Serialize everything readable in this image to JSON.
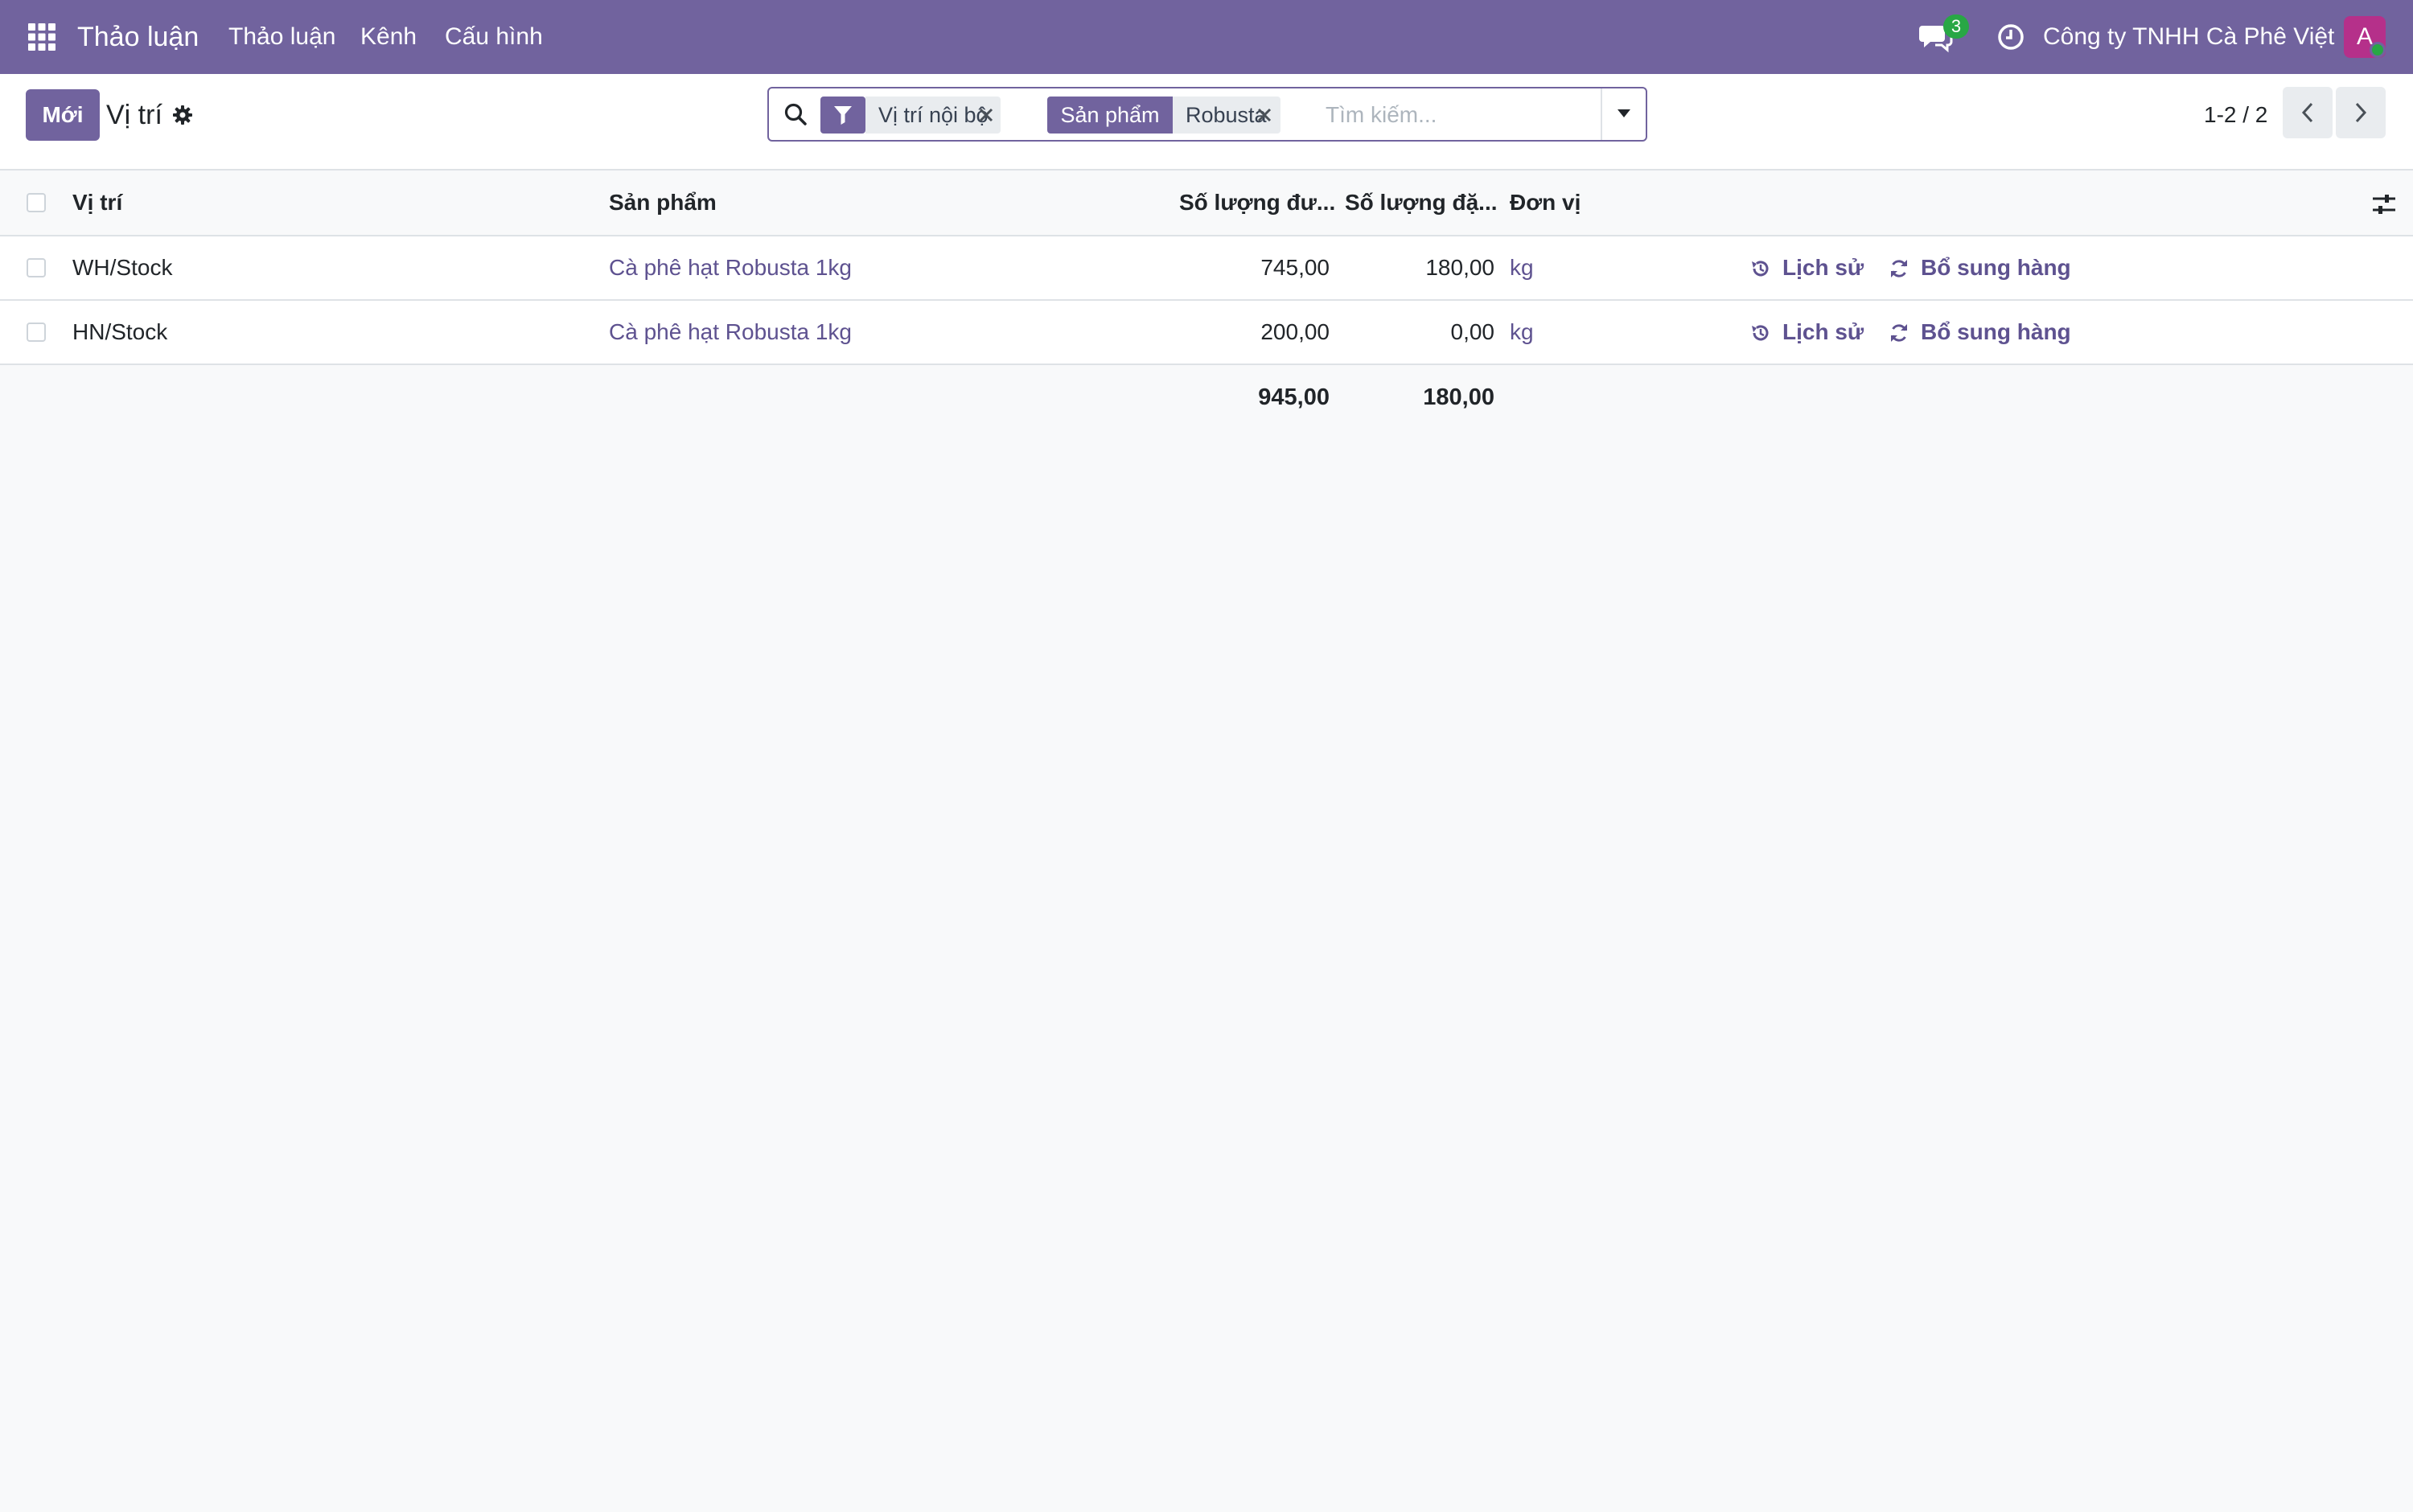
{
  "navbar": {
    "app_title": "Thảo luận",
    "menu": [
      "Thảo luận",
      "Kênh",
      "Cấu hình"
    ],
    "chat_badge": "3",
    "company": "Công ty TNHH Cà Phê Việt",
    "avatar_initial": "A"
  },
  "control": {
    "new_button": "Mới",
    "page_title": "Vị trí",
    "search": {
      "filter_facet": "Vị trí nội bộ",
      "product_facet_label": "Sản phẩm",
      "product_facet_value": "Robusta",
      "placeholder": "Tìm kiếm..."
    },
    "pager": "1-2 / 2"
  },
  "table": {
    "columns": [
      "Vị trí",
      "Sản phẩm",
      "Số lượng đư...",
      "Số lượng đặ...",
      "Đơn vị"
    ],
    "rows": [
      {
        "location": "WH/Stock",
        "product": "Cà phê hạt Robusta 1kg",
        "qty_on_hand": "745,00",
        "qty_reserved": "180,00",
        "uom": "kg",
        "history": "Lịch sử",
        "replenish": "Bổ sung hàng"
      },
      {
        "location": "HN/Stock",
        "product": "Cà phê hạt Robusta 1kg",
        "qty_on_hand": "200,00",
        "qty_reserved": "0,00",
        "uom": "kg",
        "history": "Lịch sử",
        "replenish": "Bổ sung hàng"
      }
    ],
    "totals": {
      "qty_on_hand": "945,00",
      "qty_reserved": "180,00"
    }
  },
  "colors": {
    "brand": "#71639e",
    "link": "#5e5290",
    "badge": "#28a745",
    "avatar": "#b5308a"
  },
  "icons": [
    "apps-grid-icon",
    "chat-icon",
    "clock-icon",
    "gear-icon",
    "search-icon",
    "filter-icon",
    "close-icon",
    "caret-down-icon",
    "chevron-left-icon",
    "chevron-right-icon",
    "history-icon",
    "refresh-icon",
    "sliders-icon"
  ]
}
